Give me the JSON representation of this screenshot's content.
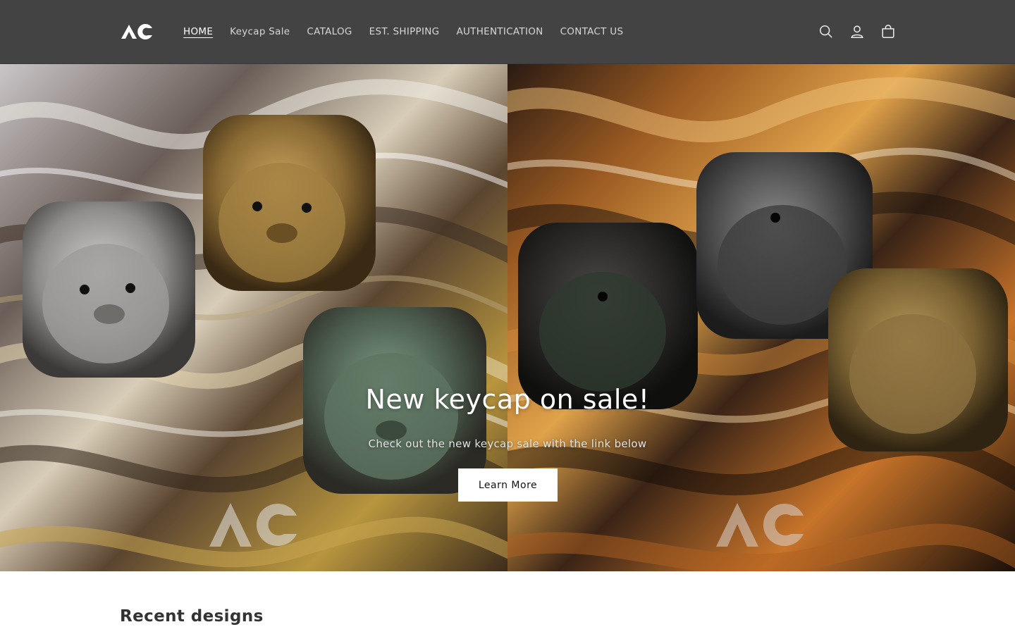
{
  "brand": {
    "logo_text": "AC"
  },
  "nav": {
    "items": [
      {
        "label": "HOME",
        "active": true
      },
      {
        "label": "Keycap Sale",
        "active": false
      },
      {
        "label": "CATALOG",
        "active": false
      },
      {
        "label": "EST. SHIPPING",
        "active": false
      },
      {
        "label": "AUTHENTICATION",
        "active": false
      },
      {
        "label": "CONTACT US",
        "active": false
      }
    ]
  },
  "header_icons": [
    "search-icon",
    "account-icon",
    "cart-icon"
  ],
  "hero": {
    "title": "New keycap on sale!",
    "subtitle": "Check out the new keycap sale with the link below",
    "button_label": "Learn More",
    "watermark_text": "AC"
  },
  "sections": {
    "recent_title": "Recent designs"
  },
  "colors": {
    "header_bg": "#434343",
    "nav_text": "#d6d6d6",
    "button_bg": "#ffffff"
  }
}
